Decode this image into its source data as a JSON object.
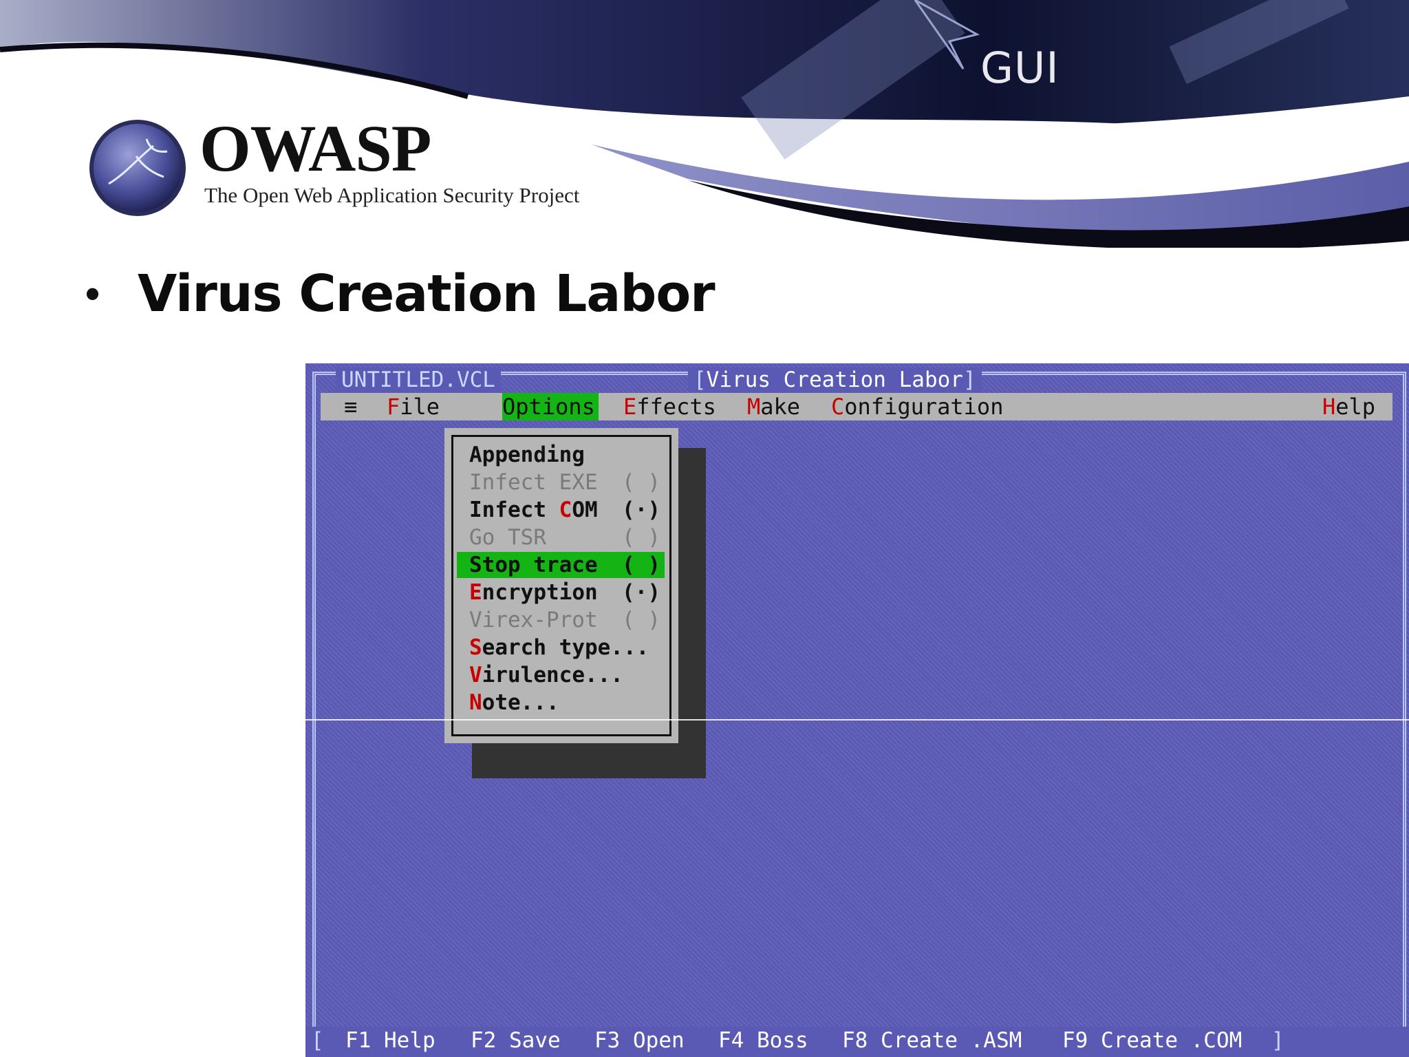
{
  "slide": {
    "title": "GUI",
    "brand": "OWASP",
    "brand_subtitle": "The Open Web Application Security Project",
    "bullet": "Virus Creation Labor"
  },
  "dos": {
    "file_title": "UNTITLED.VCL",
    "app_title": "Virus Creation Labor",
    "menu": {
      "system": "≡",
      "file": {
        "hotkey": "F",
        "rest": "ile"
      },
      "options": {
        "hotkey": "O",
        "rest": "ptions"
      },
      "effects": {
        "hotkey": "E",
        "rest": "ffects"
      },
      "make": {
        "hotkey": "M",
        "rest": "ake"
      },
      "configuration": {
        "hotkey": "C",
        "rest": "onfiguration"
      },
      "help": {
        "hotkey": "H",
        "rest": "elp"
      }
    },
    "options_menu": [
      {
        "pre": "",
        "hotkey": "",
        "post": "Appending",
        "state": "",
        "enabled": true
      },
      {
        "pre": "Infect EXE",
        "hotkey": "",
        "post": "",
        "state": "( )",
        "enabled": false
      },
      {
        "pre": "Infect ",
        "hotkey": "C",
        "post": "OM",
        "state": "(·)",
        "enabled": true
      },
      {
        "pre": "Go TSR",
        "hotkey": "",
        "post": "",
        "state": "( )",
        "enabled": false
      },
      {
        "pre": "",
        "hotkey": "",
        "post": "Stop trace",
        "state": "( )",
        "enabled": true
      },
      {
        "pre": "",
        "hotkey": "E",
        "post": "ncryption",
        "state": "(·)",
        "enabled": true
      },
      {
        "pre": "Virex-Prot",
        "hotkey": "",
        "post": "",
        "state": "( )",
        "enabled": false
      },
      {
        "pre": "",
        "hotkey": "S",
        "post": "earch type...",
        "state": "",
        "enabled": true
      },
      {
        "pre": "",
        "hotkey": "V",
        "post": "irulence...",
        "state": "",
        "enabled": true
      },
      {
        "pre": "",
        "hotkey": "N",
        "post": "ote...",
        "state": "",
        "enabled": true
      }
    ],
    "status": {
      "f1": "F1",
      "f1_label": "Help",
      "f2": "F2",
      "f2_label": "Save",
      "f3": "F3",
      "f3_label": "Open",
      "f4": "F4",
      "f4_label": "Boss",
      "f8": "F8",
      "f8_label": "Create .ASM",
      "f9": "F9",
      "f9_label": "Create .COM"
    }
  }
}
